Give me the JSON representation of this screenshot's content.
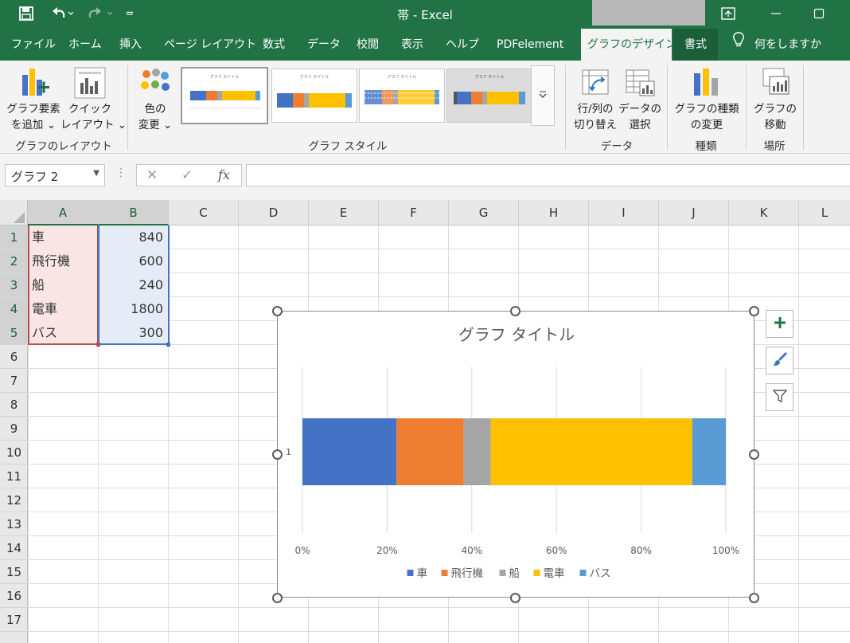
{
  "window": {
    "title": "帯  -  Excel",
    "qa_more": "="
  },
  "tabs": [
    {
      "label": "ファイル"
    },
    {
      "label": "ホーム"
    },
    {
      "label": "挿入"
    },
    {
      "label": "ページ レイアウト"
    },
    {
      "label": "数式"
    },
    {
      "label": "データ"
    },
    {
      "label": "校閲"
    },
    {
      "label": "表示"
    },
    {
      "label": "ヘルプ"
    },
    {
      "label": "PDFelement"
    },
    {
      "label": "グラフのデザイン",
      "active": true
    },
    {
      "label": "書式"
    },
    {
      "label": "何をしますか"
    }
  ],
  "ribbon": {
    "add_element": {
      "line1": "グラフ要素",
      "line2": "を追加 ⌄"
    },
    "quick_layout": {
      "line1": "クイック",
      "line2": "レイアウト ⌄"
    },
    "change_color": {
      "line1": "色の",
      "line2": "変更 ⌄"
    },
    "switch_row_col": {
      "line1": "行/列の",
      "line2": "切り替え"
    },
    "select_data": {
      "line1": "データの",
      "line2": "選択"
    },
    "change_type": {
      "line1": "グラフの種類",
      "line2": "の変更"
    },
    "move_chart": {
      "line1": "グラフの",
      "line2": "移動"
    },
    "groups": {
      "layout": "グラフのレイアウト",
      "styles": "グラフ スタイル",
      "data": "データ",
      "type": "種類",
      "location": "場所"
    },
    "style_thumb_titles": [
      "グラフ タイトル",
      "グラフ タイトル",
      "グラフ タイトル",
      "グラフ タイトル"
    ]
  },
  "formula_bar": {
    "name_box": "グラフ 2",
    "fx": "fx",
    "value": ""
  },
  "grid": {
    "columns": [
      "A",
      "B",
      "C",
      "D",
      "E",
      "F",
      "G",
      "H",
      "I",
      "J",
      "K",
      "L"
    ],
    "rows": [
      "1",
      "2",
      "3",
      "4",
      "5",
      "6",
      "7",
      "8",
      "9",
      "10",
      "11",
      "12",
      "13",
      "14",
      "15",
      "16",
      "17"
    ],
    "data": [
      {
        "a": "車",
        "b": "840"
      },
      {
        "a": "飛行機",
        "b": "600"
      },
      {
        "a": "船",
        "b": "240"
      },
      {
        "a": "電車",
        "b": "1800"
      },
      {
        "a": "バス",
        "b": "300"
      }
    ]
  },
  "chart_data": {
    "type": "bar",
    "stacked": "percent",
    "orientation": "horizontal",
    "title": "グラフ タイトル",
    "categories": [
      "1"
    ],
    "series": [
      {
        "name": "車",
        "values": [
          840
        ],
        "color": "#4472c4"
      },
      {
        "name": "飛行機",
        "values": [
          600
        ],
        "color": "#ed7d31"
      },
      {
        "name": "船",
        "values": [
          240
        ],
        "color": "#a5a5a5"
      },
      {
        "name": "電車",
        "values": [
          1800
        ],
        "color": "#ffc000"
      },
      {
        "name": "バス",
        "values": [
          300
        ],
        "color": "#5b9bd5"
      }
    ],
    "x_ticks": [
      "0%",
      "20%",
      "40%",
      "60%",
      "80%",
      "100%"
    ],
    "xlim": [
      0,
      1
    ],
    "grid": true,
    "legend": "bottom"
  },
  "colors": {
    "excel_green": "#217346",
    "range_a": "#b7504c",
    "range_b": "#4472c4"
  }
}
